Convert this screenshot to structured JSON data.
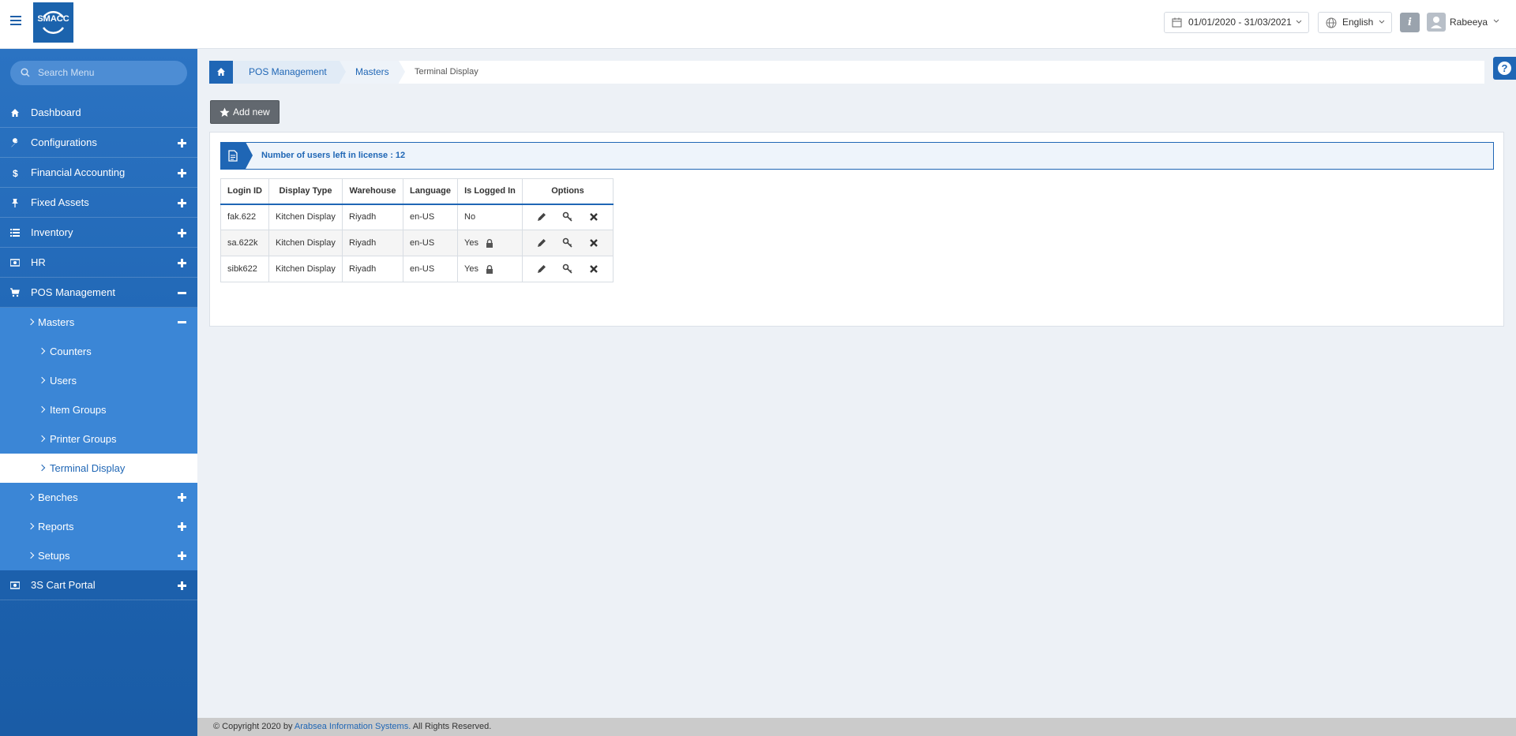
{
  "app": {
    "logo_text": "SMACC"
  },
  "header": {
    "date_range": "01/01/2020 - 31/03/2021",
    "language": "English",
    "info_label": "i",
    "user_name": "Rabeeya"
  },
  "sidebar": {
    "search_placeholder": "Search Menu",
    "items": [
      {
        "label": "Dashboard",
        "icon": "home-icon"
      },
      {
        "label": "Configurations",
        "icon": "wrench-icon"
      },
      {
        "label": "Financial Accounting",
        "icon": "dollar-icon"
      },
      {
        "label": "Fixed Assets",
        "icon": "pin-icon"
      },
      {
        "label": "Inventory",
        "icon": "list-icon"
      },
      {
        "label": "HR",
        "icon": "money-icon"
      },
      {
        "label": "POS Management",
        "icon": "cart-icon"
      },
      {
        "label": "3S Cart Portal",
        "icon": "money-icon"
      }
    ],
    "pos_sub": {
      "masters": "Masters",
      "masters_children": [
        "Counters",
        "Users",
        "Item Groups",
        "Printer Groups",
        "Terminal Display"
      ],
      "benches": "Benches",
      "reports": "Reports",
      "setups": "Setups"
    }
  },
  "breadcrumb": {
    "pos": "POS Management",
    "masters": "Masters",
    "current": "Terminal Display"
  },
  "help_label": "?",
  "toolbar": {
    "add_new": "Add new"
  },
  "license_msg": "Number of users left in license : 12",
  "table": {
    "headers": [
      "Login ID",
      "Display Type",
      "Warehouse",
      "Language",
      "Is Logged In",
      "Options"
    ],
    "rows": [
      {
        "login_id": "fak.622",
        "display_type": "Kitchen Display",
        "warehouse": "Riyadh",
        "language": "en-US",
        "logged_in": "No",
        "locked": false
      },
      {
        "login_id": "sa.622k",
        "display_type": "Kitchen Display",
        "warehouse": "Riyadh",
        "language": "en-US",
        "logged_in": "Yes",
        "locked": true
      },
      {
        "login_id": "sibk622",
        "display_type": "Kitchen Display",
        "warehouse": "Riyadh",
        "language": "en-US",
        "logged_in": "Yes",
        "locked": true
      }
    ]
  },
  "footer": {
    "prefix": "© Copyright 2020 by",
    "company": "Arabsea Information Systems.",
    "suffix": "All Rights Reserved."
  },
  "colors": {
    "primary": "#1f66b5",
    "sidebar": "#2b73c2",
    "submenu": "#3b86d6",
    "footer": "#cbcbcb"
  }
}
